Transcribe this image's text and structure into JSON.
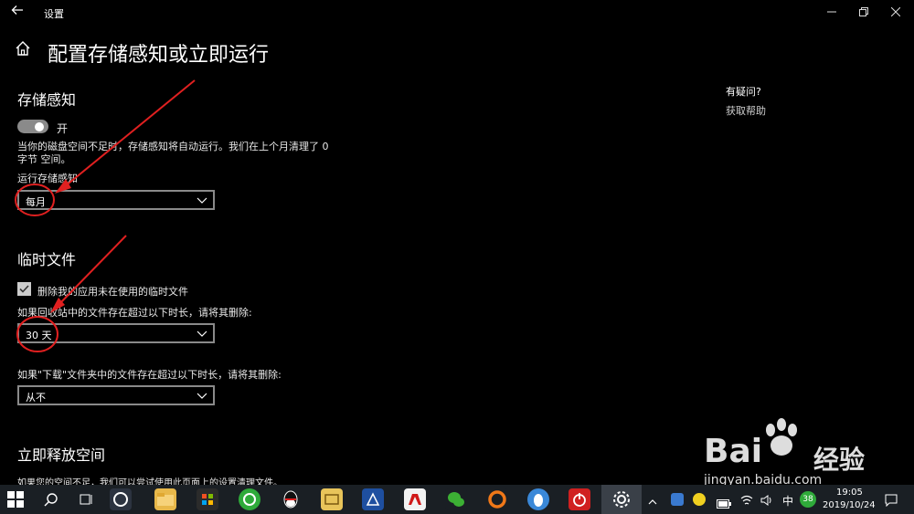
{
  "window": {
    "app_title": "设置",
    "page_title": "配置存储感知或立即运行"
  },
  "storage_sense": {
    "heading": "存储感知",
    "toggle_label": "开",
    "description_line1": "当你的磁盘空间不足时，存储感知将自动运行。我们在上个月清理了 0",
    "description_line2": "字节 空间。",
    "run_label": "运行存储感知",
    "run_value": "每月"
  },
  "temp_files": {
    "heading": "临时文件",
    "checkbox_label": "删除我的应用未在使用的临时文件",
    "recycle_label": "如果回收站中的文件存在超过以下时长，请将其删除:",
    "recycle_value": "30 天",
    "downloads_label": "如果\"下载\"文件夹中的文件存在超过以下时长，请将其删除:",
    "downloads_value": "从不"
  },
  "free_space": {
    "heading": "立即释放空间",
    "description": "如果您的空间不足，我们可以尝试使用此页面上的设置清理文件。"
  },
  "help": {
    "title": "有疑问?",
    "link": "获取帮助"
  },
  "taskbar": {
    "ime": "中",
    "badge": "38",
    "time": "19:05",
    "date": "2019/10/24"
  },
  "watermark": {
    "brand": "Bai",
    "brand_cn": "经验",
    "url": "jingyan.baidu.com"
  },
  "colors": {
    "background": "#000000",
    "annotation": "#e02020",
    "taskbar": "#1a1f24"
  }
}
